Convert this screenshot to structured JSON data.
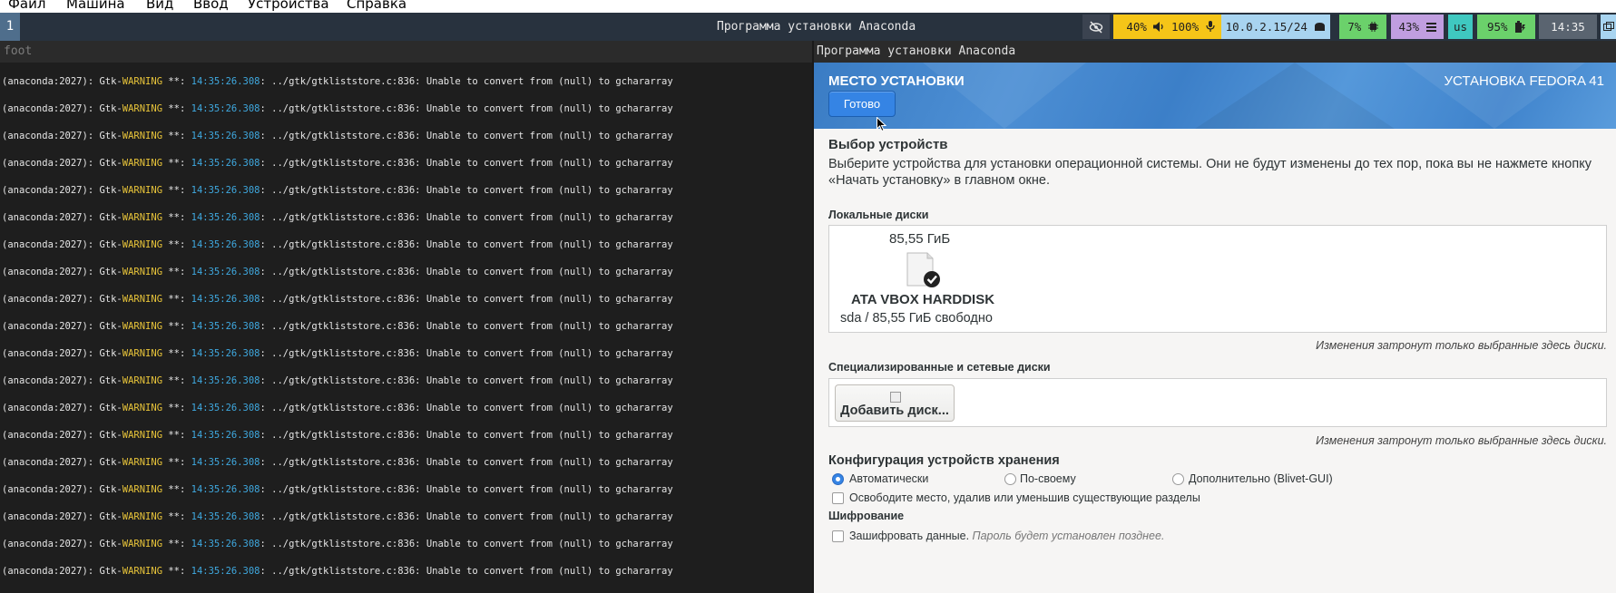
{
  "vm_menu": [
    "Файл",
    "Машина",
    "Вид",
    "Ввод",
    "Устройства",
    "Справка"
  ],
  "bar": {
    "workspace": "1",
    "title": "Программа установки Anaconda",
    "status": {
      "volume": "40%",
      "mic": "100%",
      "network": "10.0.2.15/24",
      "cpu": "7%",
      "memory": "43%",
      "layout": "us",
      "battery": "95%",
      "time": "14:35"
    },
    "colors": {
      "bar_bg": "#28323e",
      "yellow": "#f5c518",
      "blue": "#a8d4f0",
      "green": "#6bd16b",
      "purple": "#c09ee0",
      "teal": "#3fc8c0",
      "gray": "#5a6470"
    }
  },
  "terminal": {
    "title": "foot",
    "line": {
      "prefix": "(anaconda:2027): Gtk-",
      "level": "WARNING",
      "sep": " **: ",
      "time": "14:35:26.308",
      "message": ": ../gtk/gtkliststore.c:836: Unable to convert from (null) to gchararray"
    }
  },
  "anaconda": {
    "window_title": "Программа установки Anaconda",
    "header_title": "МЕСТО УСТАНОВКИ",
    "header_right": "УСТАНОВКА FEDORA 41",
    "done_button": "Готово",
    "device_selection_title": "Выбор устройств",
    "device_selection_desc_1": "Выберите устройства для установки операционной системы. Они не будут изменены до тех пор, пока вы не нажмете кнопку",
    "device_selection_desc_2": "«Начать установку» в главном окне.",
    "local_disks_title": "Локальные диски",
    "disk": {
      "size": "85,55 ГиБ",
      "name": "ATA VBOX HARDDISK",
      "free": "sda  /  85,55 ГиБ свободно",
      "icon": "harddisk-icon"
    },
    "changes_note": "Изменения затронут только выбранные здесь диски.",
    "special_disks_title": "Специализированные и сетевые диски",
    "add_disk_button": "Добавить диск...",
    "storage_config_title": "Конфигурация устройств хранения",
    "storage_options": [
      "Автоматически",
      "По-своему",
      "Дополнительно (Blivet-GUI)"
    ],
    "storage_selected": "Автоматически",
    "reclaim_label": "Освободите место, удалив или уменьшив существующие разделы",
    "encryption_title": "Шифрование",
    "encrypt_label": "Зашифровать данные.",
    "encrypt_hint": "Пароль будет установлен позднее."
  }
}
